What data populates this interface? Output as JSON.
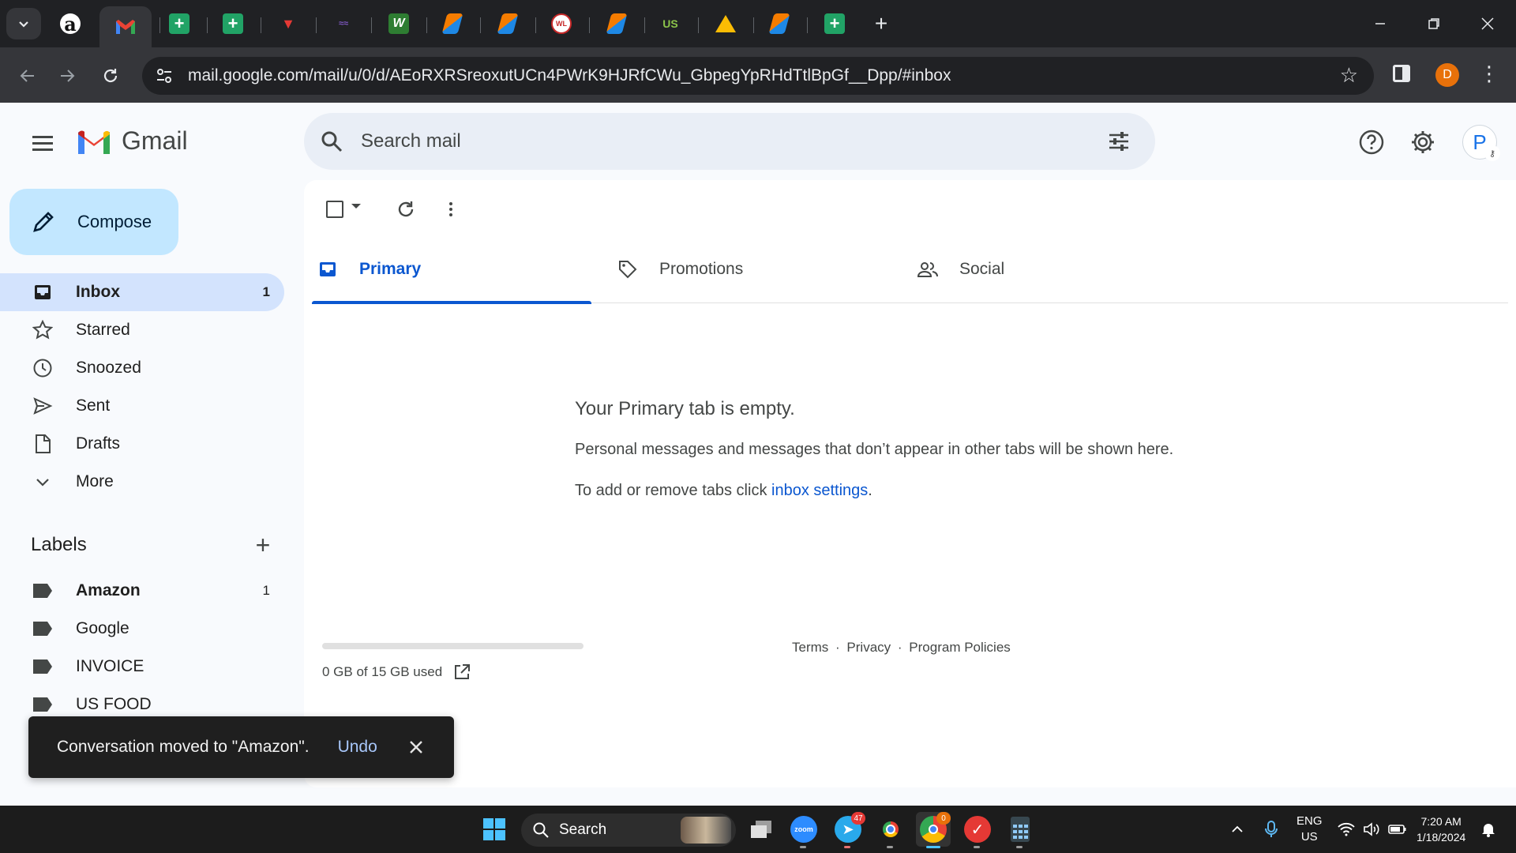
{
  "browser": {
    "url": "mail.google.com/mail/u/0/d/AEoRXRSreoxutUCn4PWrK9HJRfCWu_GbpegYpRHdTtlBpGf__Dpp/#inbox",
    "profile_initial": "D",
    "tabs": [
      {
        "icon": "amazon-icon",
        "glyph": "a"
      },
      {
        "icon": "gmail-icon",
        "glyph": "M",
        "active": true
      },
      {
        "icon": "sheets-icon",
        "glyph": "+"
      },
      {
        "icon": "sheets-icon",
        "glyph": "+"
      },
      {
        "icon": "red-logo-icon",
        "glyph": "▼"
      },
      {
        "icon": "purple-logo-icon",
        "glyph": "≈"
      },
      {
        "icon": "w-logo-icon",
        "glyph": "W"
      },
      {
        "icon": "orange-app-icon",
        "glyph": ""
      },
      {
        "icon": "orange-app-icon",
        "glyph": ""
      },
      {
        "icon": "circle-logo-icon",
        "glyph": "WL"
      },
      {
        "icon": "orange-app-icon",
        "glyph": ""
      },
      {
        "icon": "usfoods-icon",
        "glyph": "US"
      },
      {
        "icon": "drive-icon",
        "glyph": ""
      },
      {
        "icon": "orange-app-icon",
        "glyph": ""
      },
      {
        "icon": "sheets-icon",
        "glyph": "+"
      }
    ]
  },
  "gmail": {
    "brand": "Gmail",
    "search_placeholder": "Search mail",
    "account_initial": "P",
    "compose_label": "Compose",
    "nav": [
      {
        "label": "Inbox",
        "icon": "inbox-icon",
        "count": "1",
        "active": true
      },
      {
        "label": "Starred",
        "icon": "star-icon",
        "count": ""
      },
      {
        "label": "Snoozed",
        "icon": "clock-icon",
        "count": ""
      },
      {
        "label": "Sent",
        "icon": "send-icon",
        "count": ""
      },
      {
        "label": "Drafts",
        "icon": "draft-icon",
        "count": ""
      },
      {
        "label": "More",
        "icon": "chevron-down-icon",
        "count": ""
      }
    ],
    "labels_heading": "Labels",
    "labels": [
      {
        "label": "Amazon",
        "count": "1",
        "bold": true
      },
      {
        "label": "Google",
        "count": ""
      },
      {
        "label": "INVOICE",
        "count": ""
      },
      {
        "label": "US FOOD",
        "count": ""
      }
    ],
    "inbox_tabs": [
      {
        "label": "Primary",
        "icon": "inbox-tab-icon",
        "active": true
      },
      {
        "label": "Promotions",
        "icon": "tag-icon"
      },
      {
        "label": "Social",
        "icon": "people-icon"
      }
    ],
    "empty_state": {
      "title": "Your Primary tab is empty.",
      "description": "Personal messages and messages that don’t appear in other tabs will be shown here.",
      "hint_prefix": "To add or remove tabs click ",
      "hint_link": "inbox settings",
      "hint_suffix": "."
    },
    "storage": {
      "text": "0 GB of 15 GB used",
      "fraction_used": 0
    },
    "footer": {
      "terms": "Terms",
      "privacy": "Privacy",
      "policies": "Program Policies",
      "separator": "·"
    },
    "snackbar": {
      "message": "Conversation moved to \"Amazon\".",
      "action": "Undo"
    }
  },
  "taskbar": {
    "search_label": "Search",
    "language_line1": "ENG",
    "language_line2": "US",
    "time": "7:20 AM",
    "date": "1/18/2024",
    "telegram_badge": "47",
    "chrome_badge": "0",
    "zoom_label": "zoom"
  },
  "colors": {
    "accent": "#0b57d0",
    "compose_bg": "#c2e7ff",
    "active_nav_bg": "#d3e3fd",
    "snackbar_bg": "#1f1f1f",
    "undo": "#a8c7fa"
  }
}
